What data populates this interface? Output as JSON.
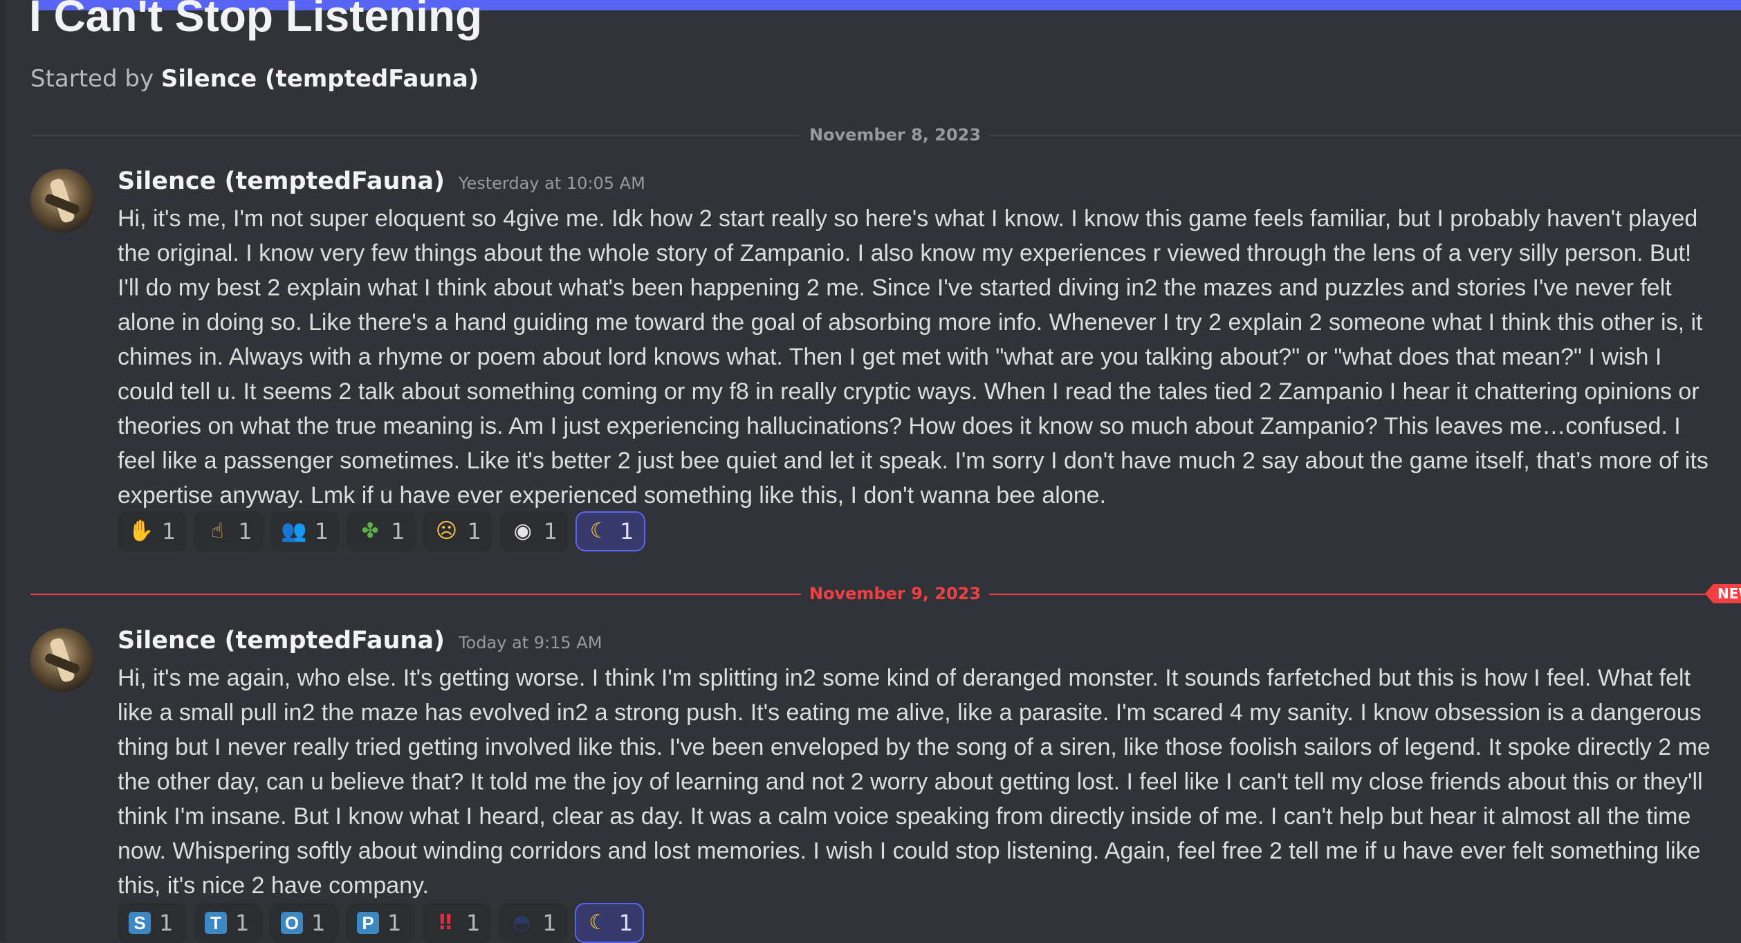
{
  "thread": {
    "title": "I Can't Stop Listening",
    "started_by_prefix": "Started by",
    "started_by_author": "Silence (temptedFauna)"
  },
  "dividers": {
    "first_date": "November 8, 2023",
    "second_date": "November 9, 2023",
    "new_badge": "NEW"
  },
  "messages": [
    {
      "author": "Silence (temptedFauna)",
      "timestamp": "Yesterday at 10:05 AM",
      "text": "Hi, it's me, I'm not super eloquent so 4give me. Idk how 2 start really so here's what I know. I know this game feels familiar, but I probably haven't played the original. I know very few things about the whole story of Zampanio. I also know my experiences r viewed through the lens of a very silly person. But! I'll do my best 2 explain what I think about what's been happening 2 me. Since I've started diving in2 the mazes and puzzles and stories I've never felt alone in doing so. Like there's a hand guiding me toward the goal of absorbing more info. Whenever I try 2 explain 2 someone what I think this other is, it chimes in. Always with a rhyme or poem about lord knows what. Then I get met with \"what are you talking about?\" or \"what does that mean?\" I wish I could tell u. It seems 2 talk about something coming or my f8 in really cryptic ways. When I read the tales tied 2 Zampanio I hear it chattering opinions or theories on what the true meaning is. Am I just experiencing hallucinations? How does it know so much about Zampanio? This leaves me…confused. I feel like a passenger sometimes. Like it's better 2 just bee quiet and let it speak. I'm sorry I don't have much 2 say about the game itself, that’s more of its expertise anyway. Lmk if u have ever experienced something like this, I don't wanna bee alone.",
      "reactions": [
        {
          "icon": "raised-hand-emoji",
          "glyph": "✋",
          "color": "#f7c04a",
          "count": "1",
          "active": false
        },
        {
          "icon": "pointing-up-emoji",
          "glyph": "☝",
          "color": "#f7c04a",
          "count": "1",
          "active": false
        },
        {
          "icon": "two-people-emoji",
          "glyph": "👥",
          "color": "#5aa0e0",
          "count": "1",
          "active": false
        },
        {
          "icon": "puzzle-piece-emoji",
          "glyph": "✤",
          "color": "#5fae4c",
          "count": "1",
          "active": false
        },
        {
          "icon": "confounded-face-emoji",
          "glyph": "☹",
          "color": "#f7c04a",
          "count": "1",
          "active": false
        },
        {
          "icon": "eye-emoji",
          "glyph": "◉",
          "color": "#e6e6e6",
          "count": "1",
          "active": false
        },
        {
          "icon": "crescent-moon-emoji",
          "glyph": "☾",
          "color": "#f7d038",
          "count": "1",
          "active": true
        }
      ]
    },
    {
      "author": "Silence (temptedFauna)",
      "timestamp": "Today at 9:15 AM",
      "text": "Hi, it's me again, who else. It's getting worse. I think I'm splitting in2 some kind of deranged monster. It sounds farfetched but this is how I feel. What felt like a small pull in2 the maze has evolved in2 a strong push. It's eating me alive, like a parasite. I'm scared 4 my sanity. I know obsession is a dangerous thing but I never really tried getting involved like this. I've been enveloped by the song of a siren, like those foolish sailors of legend. It spoke directly 2 me the other day, can u believe that? It told me the joy of learning and not 2 worry about getting lost. I feel like I can't tell my close friends about this or they'll think I'm insane. But I know what I heard, clear as day. It was a calm voice speaking from directly inside of me. I can't help but hear it almost all the time now. Whispering softly about winding corridors and lost memories. I wish I could stop listening. Again, feel free 2 tell me if u have ever felt something like this, it's nice 2 have company.",
      "reactions": [
        {
          "icon": "regional-indicator-s",
          "glyph": "S",
          "tile": true,
          "count": "1",
          "active": false
        },
        {
          "icon": "regional-indicator-t",
          "glyph": "T",
          "tile": true,
          "count": "1",
          "active": false
        },
        {
          "icon": "regional-indicator-o",
          "glyph": "O",
          "tile": true,
          "count": "1",
          "active": false
        },
        {
          "icon": "regional-indicator-p",
          "glyph": "P",
          "tile": true,
          "count": "1",
          "active": false
        },
        {
          "icon": "double-exclamation-emoji",
          "glyph": "‼",
          "color": "#dd2e44",
          "count": "1",
          "active": false
        },
        {
          "icon": "ninja-face-emoji",
          "glyph": "◓",
          "color": "#2a3a66",
          "count": "1",
          "active": false
        },
        {
          "icon": "crescent-moon-emoji",
          "glyph": "☾",
          "color": "#f7d038",
          "count": "1",
          "active": true
        }
      ]
    }
  ]
}
